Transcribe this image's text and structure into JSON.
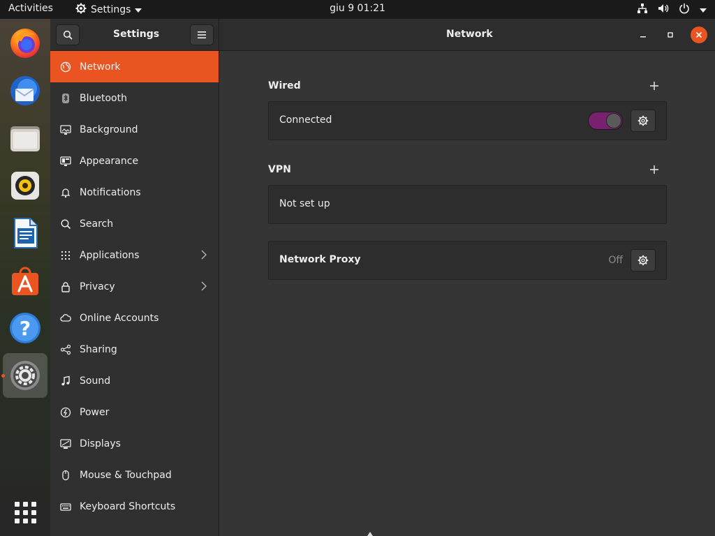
{
  "topbar": {
    "activities": "Activities",
    "app_menu": "Settings",
    "clock": "giu 9  01:21",
    "tray_icons": [
      "network-wired-icon",
      "volume-icon",
      "power-icon",
      "chevron-down-icon"
    ]
  },
  "dock": {
    "apps": [
      {
        "name": "firefox",
        "icon": "firefox-icon"
      },
      {
        "name": "thunderbird",
        "icon": "thunderbird-icon"
      },
      {
        "name": "files",
        "icon": "files-icon"
      },
      {
        "name": "rhythmbox",
        "icon": "rhythmbox-icon"
      },
      {
        "name": "writer",
        "icon": "libreoffice-writer-icon"
      },
      {
        "name": "software",
        "icon": "software-store-icon"
      },
      {
        "name": "help",
        "icon": "help-icon"
      },
      {
        "name": "settings",
        "icon": "settings-icon",
        "active": true
      }
    ],
    "show_apps_icon": "app-grid-icon"
  },
  "window": {
    "sidebar_title": "Settings",
    "page_title": "Network",
    "colors": {
      "accent": "#e95420",
      "switch_on": "#77216f"
    }
  },
  "sidebar": {
    "items": [
      {
        "label": "Network",
        "icon": "network-icon",
        "selected": true
      },
      {
        "label": "Bluetooth",
        "icon": "bluetooth-icon"
      },
      {
        "label": "Background",
        "icon": "background-icon"
      },
      {
        "label": "Appearance",
        "icon": "appearance-icon"
      },
      {
        "label": "Notifications",
        "icon": "bell-icon"
      },
      {
        "label": "Search",
        "icon": "search-icon"
      },
      {
        "label": "Applications",
        "icon": "applications-icon",
        "has_chevron": true
      },
      {
        "label": "Privacy",
        "icon": "lock-icon",
        "has_chevron": true
      },
      {
        "label": "Online Accounts",
        "icon": "cloud-icon"
      },
      {
        "label": "Sharing",
        "icon": "share-icon"
      },
      {
        "label": "Sound",
        "icon": "music-note-icon"
      },
      {
        "label": "Power",
        "icon": "power-icon"
      },
      {
        "label": "Displays",
        "icon": "display-icon"
      },
      {
        "label": "Mouse & Touchpad",
        "icon": "mouse-icon"
      },
      {
        "label": "Keyboard Shortcuts",
        "icon": "keyboard-icon"
      }
    ]
  },
  "content": {
    "wired": {
      "title": "Wired",
      "status": "Connected",
      "switch_on": true
    },
    "vpn": {
      "title": "VPN",
      "status": "Not set up"
    },
    "proxy": {
      "title": "Network Proxy",
      "status": "Off"
    }
  }
}
